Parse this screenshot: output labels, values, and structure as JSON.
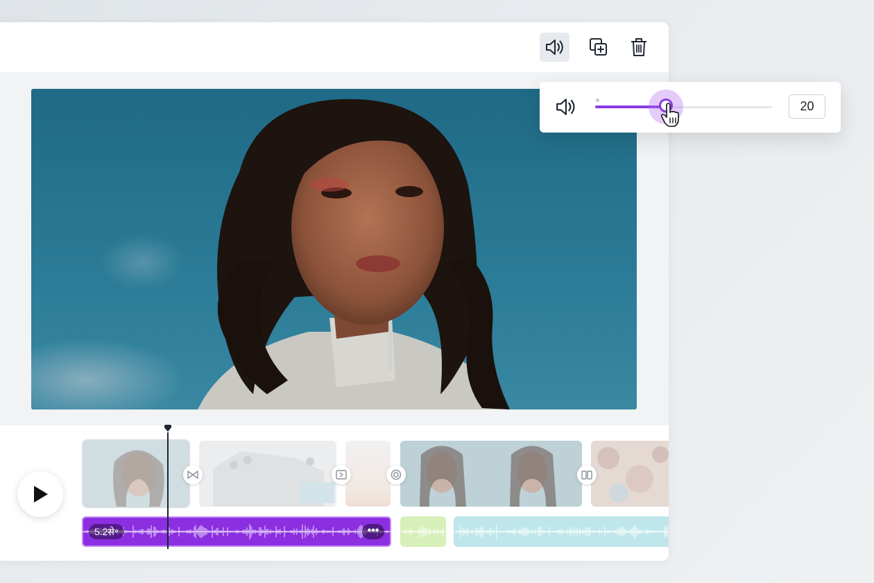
{
  "toolbar": {
    "buttons": [
      {
        "name": "volume",
        "icon": "speaker-icon",
        "active": true
      },
      {
        "name": "duplicate",
        "icon": "duplicate-page-icon",
        "active": false
      },
      {
        "name": "delete",
        "icon": "trash-icon",
        "active": false
      }
    ]
  },
  "volume_popup": {
    "icon": "speaker-icon",
    "value": "20",
    "slider_level_percent": 40,
    "accent": "#8b3ae6"
  },
  "timeline": {
    "play_icon": "play-icon",
    "clips": [
      {
        "name": "clip-1",
        "kind": "portrait-sky",
        "selected": true
      },
      {
        "name": "clip-2",
        "kind": "white-architecture"
      },
      {
        "name": "clip-3",
        "kind": "gradient"
      },
      {
        "name": "clip-4",
        "kind": "portrait-pair"
      },
      {
        "name": "clip-5",
        "kind": "blossom"
      }
    ],
    "transitions": [
      {
        "icon": "bowtie-transition-icon"
      },
      {
        "icon": "slide-transition-icon"
      },
      {
        "icon": "circle-transition-icon"
      },
      {
        "icon": "split-transition-icon"
      }
    ],
    "audio_tracks": [
      {
        "name": "audio-main",
        "duration_label": "5.2से॰",
        "more_label": "•••",
        "color": "#8b2fe0"
      },
      {
        "name": "audio-green",
        "color": "#d7efb8"
      },
      {
        "name": "audio-teal",
        "color": "#bfe6ea"
      }
    ]
  }
}
